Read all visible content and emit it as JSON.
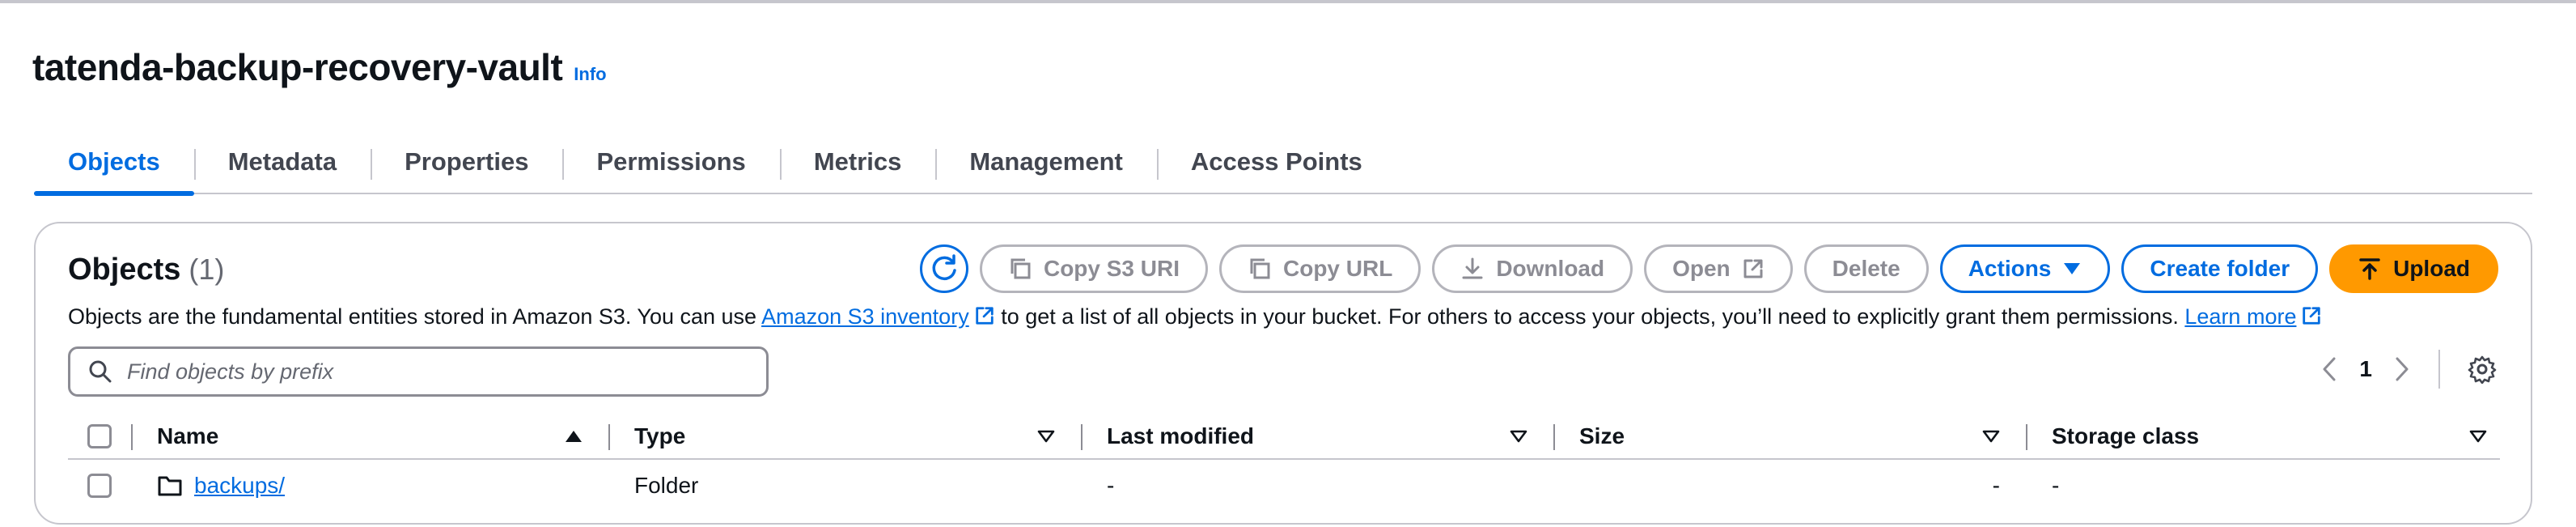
{
  "header": {
    "title": "tatenda-backup-recovery-vault",
    "info": "Info"
  },
  "tabs": [
    "Objects",
    "Metadata",
    "Properties",
    "Permissions",
    "Metrics",
    "Management",
    "Access Points"
  ],
  "active_tab": "Objects",
  "objects": {
    "title": "Objects",
    "count": "(1)",
    "description_pre": "Objects are the fundamental entities stored in Amazon S3. You can use ",
    "inventory_link": "Amazon S3 inventory",
    "description_mid": " to get a list of all objects in your bucket. For others to access your objects, you’ll need to explicitly grant them permissions. ",
    "learn_more": "Learn more"
  },
  "toolbar": {
    "copy_s3_uri": "Copy S3 URI",
    "copy_url": "Copy URL",
    "download": "Download",
    "open": "Open",
    "delete": "Delete",
    "actions": "Actions",
    "create_folder": "Create folder",
    "upload": "Upload"
  },
  "search": {
    "placeholder": "Find objects by prefix"
  },
  "pagination": {
    "page": "1"
  },
  "table": {
    "columns": [
      "Name",
      "Type",
      "Last modified",
      "Size",
      "Storage class"
    ],
    "rows": [
      {
        "name": "backups/",
        "type": "Folder",
        "last_modified": "-",
        "size": "-",
        "storage_class": "-"
      }
    ]
  },
  "colors": {
    "accent": "#006ce0",
    "upload": "#ff9900",
    "border": "#c6c6cd"
  }
}
